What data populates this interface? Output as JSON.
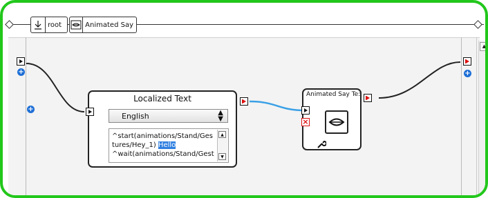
{
  "breadcrumb": {
    "items": [
      {
        "label": "root",
        "icon": "download-arrow-icon"
      },
      {
        "label": "Animated Say",
        "icon": "speech-mouth-icon"
      }
    ]
  },
  "nodes": {
    "localized_text": {
      "title": "Localized Text",
      "language": "English",
      "script_lines": [
        {
          "before": "^start(animations/Stand/Ges",
          "highlight": ""
        },
        {
          "before": "tures/Hey_1) ",
          "highlight": "Hello"
        },
        {
          "before": "^wait(animations/Stand/Gest",
          "highlight": ""
        }
      ]
    },
    "animated_say_text": {
      "title": "Animated Say Te:",
      "icon": "speech-mouth-icon"
    }
  },
  "colors": {
    "frame_border": "#22c71b",
    "link_active": "#3aa0e6",
    "port_red": "#d11111",
    "plus_blue": "#1e6fd6",
    "highlight": "#2f7fe0"
  }
}
